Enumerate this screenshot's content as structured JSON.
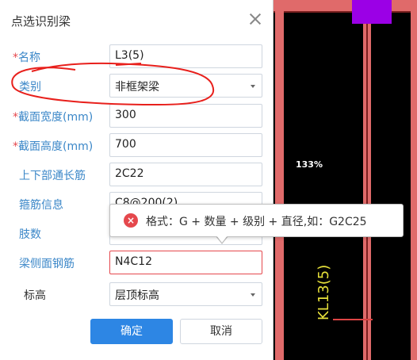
{
  "dialog": {
    "title": "点选识别梁",
    "fields": {
      "name": {
        "label": "名称",
        "value": "L3(5)"
      },
      "category": {
        "label": "类别",
        "value": "非框架梁"
      },
      "section_width": {
        "label": "截面宽度(mm)",
        "value": "300"
      },
      "section_height": {
        "label": "截面高度(mm)",
        "value": "700"
      },
      "through_rebar": {
        "label": "上下部通长筋",
        "value": "2C22"
      },
      "stirrup": {
        "label": "箍筋信息",
        "value": "C8@200(2)"
      },
      "legs": {
        "label": "肢数",
        "value": ""
      },
      "side_rebar": {
        "label": "梁侧面钢筋",
        "value": "N4C12"
      },
      "elevation": {
        "label": "标高",
        "value": "层顶标高"
      }
    },
    "required_mark": "*",
    "ok_label": "确定",
    "cancel_label": "取消"
  },
  "tooltip": {
    "icon": "error-icon",
    "icon_glyph": "×",
    "text": "格式：G + 数量 + 级别 + 直径,如：G2C25"
  },
  "canvas": {
    "zoom": "133%",
    "beam_label": "KL13(5)"
  },
  "colors": {
    "accent": "#2d86e4",
    "label": "#3b87c8",
    "error": "#e5484d",
    "beam": "#e06a6a",
    "column": "#9b00e6"
  }
}
